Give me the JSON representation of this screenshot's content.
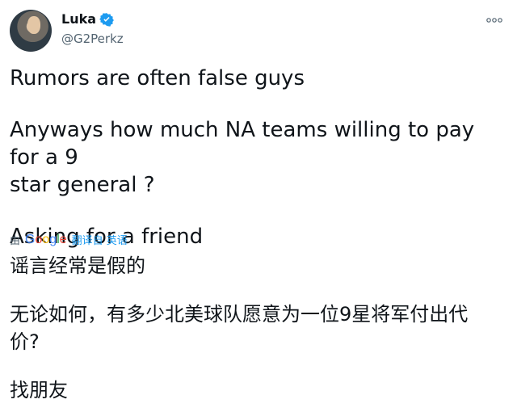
{
  "user": {
    "display_name": "Luka",
    "handle": "@G2Perkz"
  },
  "tweet": {
    "line1": "Rumors are often false guys",
    "line2": "Anyways how much NA teams willing to pay for a 9",
    "line3": "star general ?",
    "line4": "Asking for a friend"
  },
  "translation": {
    "by_label": "由",
    "provider_letters": [
      "G",
      "o",
      "o",
      "g",
      "l",
      "e"
    ],
    "translate_link": "翻译自 英语",
    "line1": "谣言经常是假的",
    "line2": "无论如何，有多少北美球队愿意为一位9星将军付出代",
    "line3": "价?",
    "line4": "找朋友"
  },
  "icons": {
    "verified": "verified-badge-icon",
    "more": "more-icon"
  },
  "colors": {
    "accent": "#1d9bf0",
    "secondary_text": "#536471",
    "primary_text": "#0f1419"
  }
}
